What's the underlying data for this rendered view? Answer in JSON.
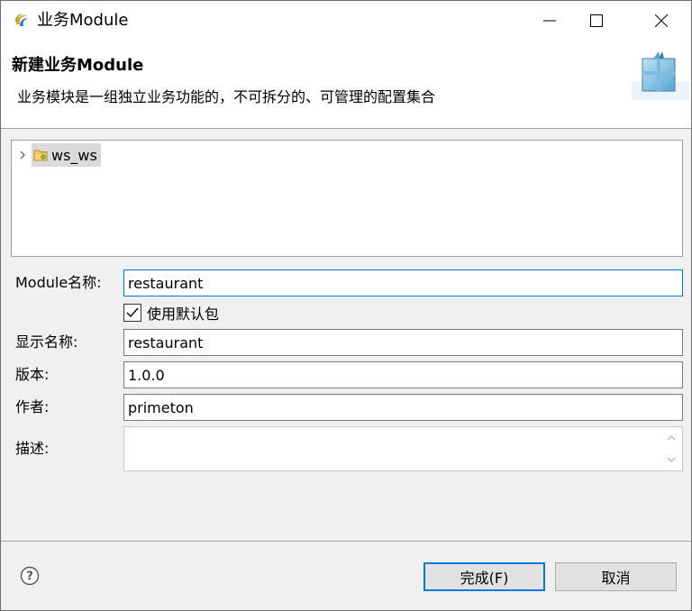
{
  "window": {
    "title": "业务Module",
    "minimize_icon": "minimize-icon",
    "maximize_icon": "maximize-icon",
    "close_icon": "close-icon"
  },
  "banner": {
    "title": "新建业务Module",
    "description": "业务模块是一组独立业务功能的，不可拆分的、可管理的配置集合",
    "icon": "package-box-icon"
  },
  "tree": {
    "items": [
      {
        "label": "ws_ws",
        "icon": "folder-icon",
        "expanded": false,
        "selected": true
      }
    ]
  },
  "form": {
    "module_name": {
      "label": "Module名称:",
      "value": "restaurant"
    },
    "use_default_package": {
      "label": "使用默认包",
      "checked": true
    },
    "display_name": {
      "label": "显示名称:",
      "value": "restaurant"
    },
    "version": {
      "label": "版本:",
      "value": "1.0.0"
    },
    "author": {
      "label": "作者:",
      "value": "primeton"
    },
    "description": {
      "label": "描述:",
      "value": ""
    }
  },
  "footer": {
    "help_icon": "help-icon",
    "finish_label": "完成(F)",
    "cancel_label": "取消"
  },
  "colors": {
    "accent": "#0078d7",
    "background": "#f0f0f0",
    "selection": "#dadada"
  }
}
